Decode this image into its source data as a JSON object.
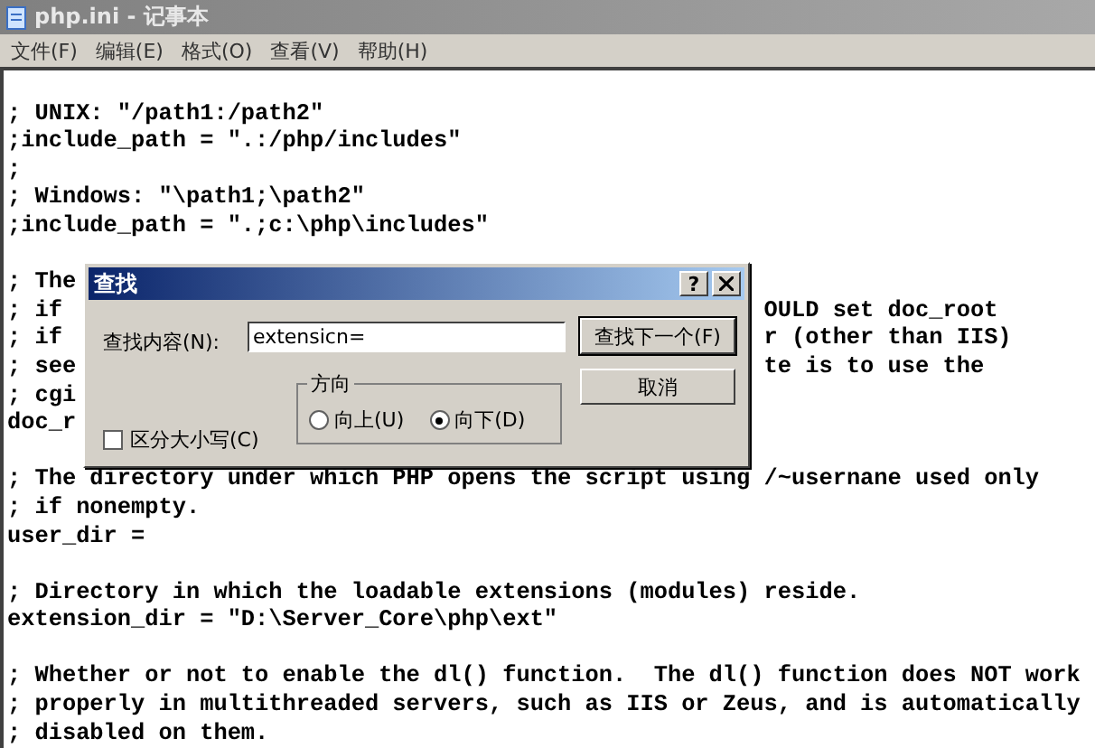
{
  "window": {
    "title": "php.ini - 记事本"
  },
  "menu": [
    {
      "label": "文件(F)"
    },
    {
      "label": "编辑(E)"
    },
    {
      "label": "格式(O)"
    },
    {
      "label": "查看(V)"
    },
    {
      "label": "帮助(H)"
    }
  ],
  "editor": {
    "paragraphs": [
      {
        "lines": [
          {
            "text": "; UNIX: \"/path1:/path2\""
          },
          {
            "text": ";include_path = \".:/php/includes\""
          },
          {
            "text": ";"
          },
          {
            "text": "; Windows: \"\\path1;\\path2\""
          },
          {
            "text": ";include_path = \".;c:\\php\\includes\""
          }
        ]
      },
      {
        "lines": [
          {
            "text": "; The"
          },
          {
            "text": "; if",
            "right": "OULD set doc_root"
          },
          {
            "text": "; if",
            "right": "r (other than IIS)"
          },
          {
            "text": "; see",
            "right": "te is to use the"
          },
          {
            "text": "; cgi"
          },
          {
            "text": "doc_r"
          }
        ]
      },
      {
        "lines": [
          {
            "text": "; The directory under which PHP opens the script using /~usernane used only"
          },
          {
            "text": "; if nonempty."
          },
          {
            "text": "user_dir ="
          }
        ]
      },
      {
        "lines": [
          {
            "text": "; Directory in which the loadable extensions (modules) reside."
          },
          {
            "text": "extension_dir = \"D:\\Server_Core\\php\\ext\""
          }
        ]
      },
      {
        "lines": [
          {
            "text": "; Whether or not to enable the dl() function.  The dl() function does NOT work"
          },
          {
            "text": "; properly in multithreaded servers, such as IIS or Zeus, and is automatically"
          },
          {
            "text": "; disabled on them."
          }
        ]
      }
    ]
  },
  "find_dialog": {
    "title": "查找",
    "help": "?",
    "find_label": "查找内容(N):",
    "find_value": "extensicn=",
    "match_case": {
      "label": "区分大小写(C)",
      "checked": false
    },
    "direction": {
      "title": "方向",
      "options": [
        {
          "label": "向上(U)",
          "selected": false
        },
        {
          "label": "向下(D)",
          "selected": true
        }
      ]
    },
    "buttons": [
      {
        "label": "查找下一个(F)",
        "default": true
      },
      {
        "label": "取消",
        "default": false
      }
    ]
  }
}
